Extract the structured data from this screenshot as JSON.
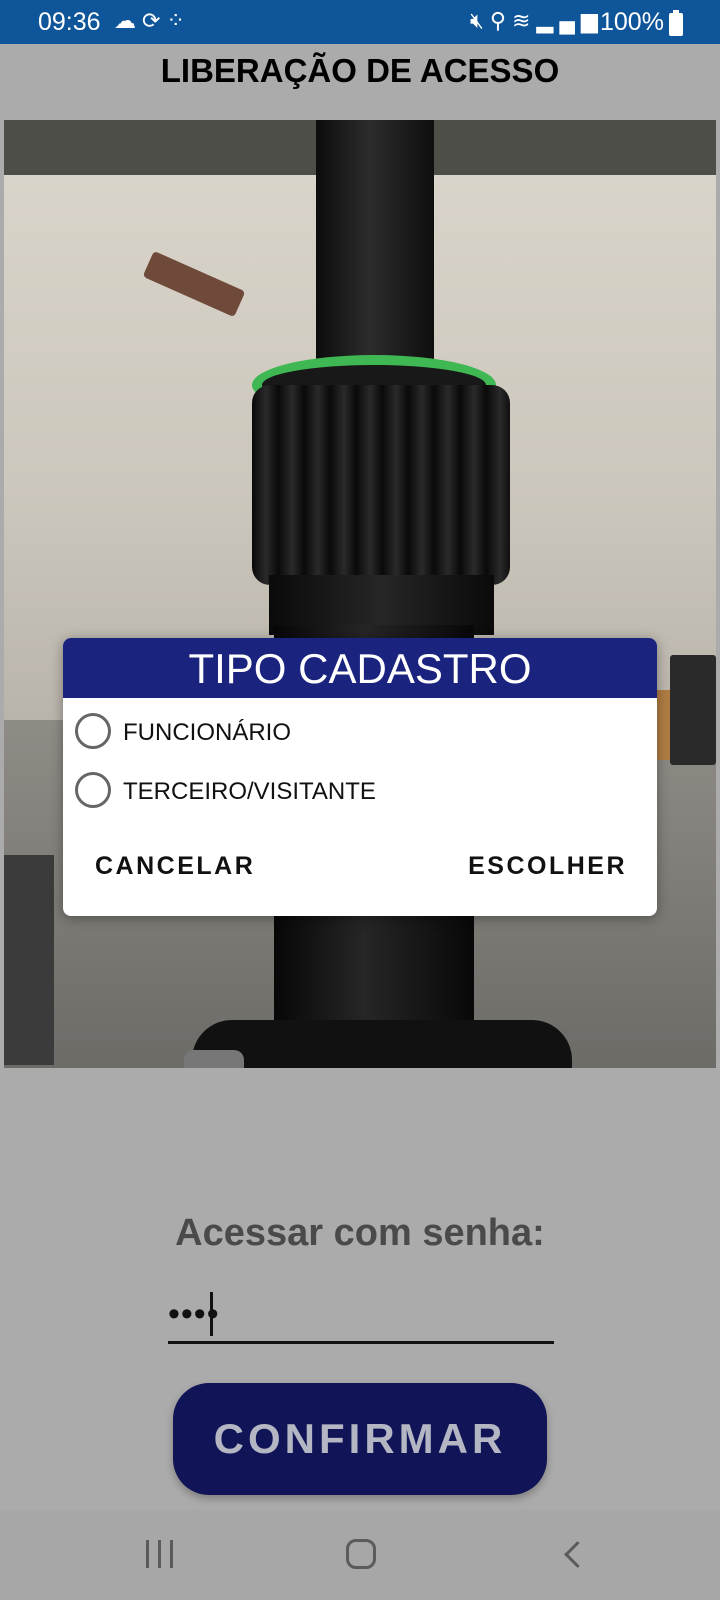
{
  "status_bar": {
    "time": "09:36",
    "left_icons": [
      "cloud-icon",
      "sync-icon",
      "apps-icon"
    ],
    "right_icons": [
      "mute-icon",
      "location-icon",
      "wifi-icon",
      "signal-icon"
    ],
    "battery": "100%"
  },
  "app": {
    "title": "LIBERAÇÃO DE ACESSO"
  },
  "dialog": {
    "title": "TIPO CADASTRO",
    "options": [
      {
        "label": "FUNCIONÁRIO",
        "selected": false
      },
      {
        "label": "TERCEIRO/VISITANTE",
        "selected": false
      }
    ],
    "cancel_label": "CANCELAR",
    "choose_label": "ESCOLHER"
  },
  "password": {
    "label": "Acessar com senha:",
    "value": "••••"
  },
  "confirm_label": "CONFIRMAR",
  "colors": {
    "status_bar": "#0e5599",
    "dialog_header": "#1a237e",
    "confirm_button": "#111557",
    "background": "#ababab"
  }
}
